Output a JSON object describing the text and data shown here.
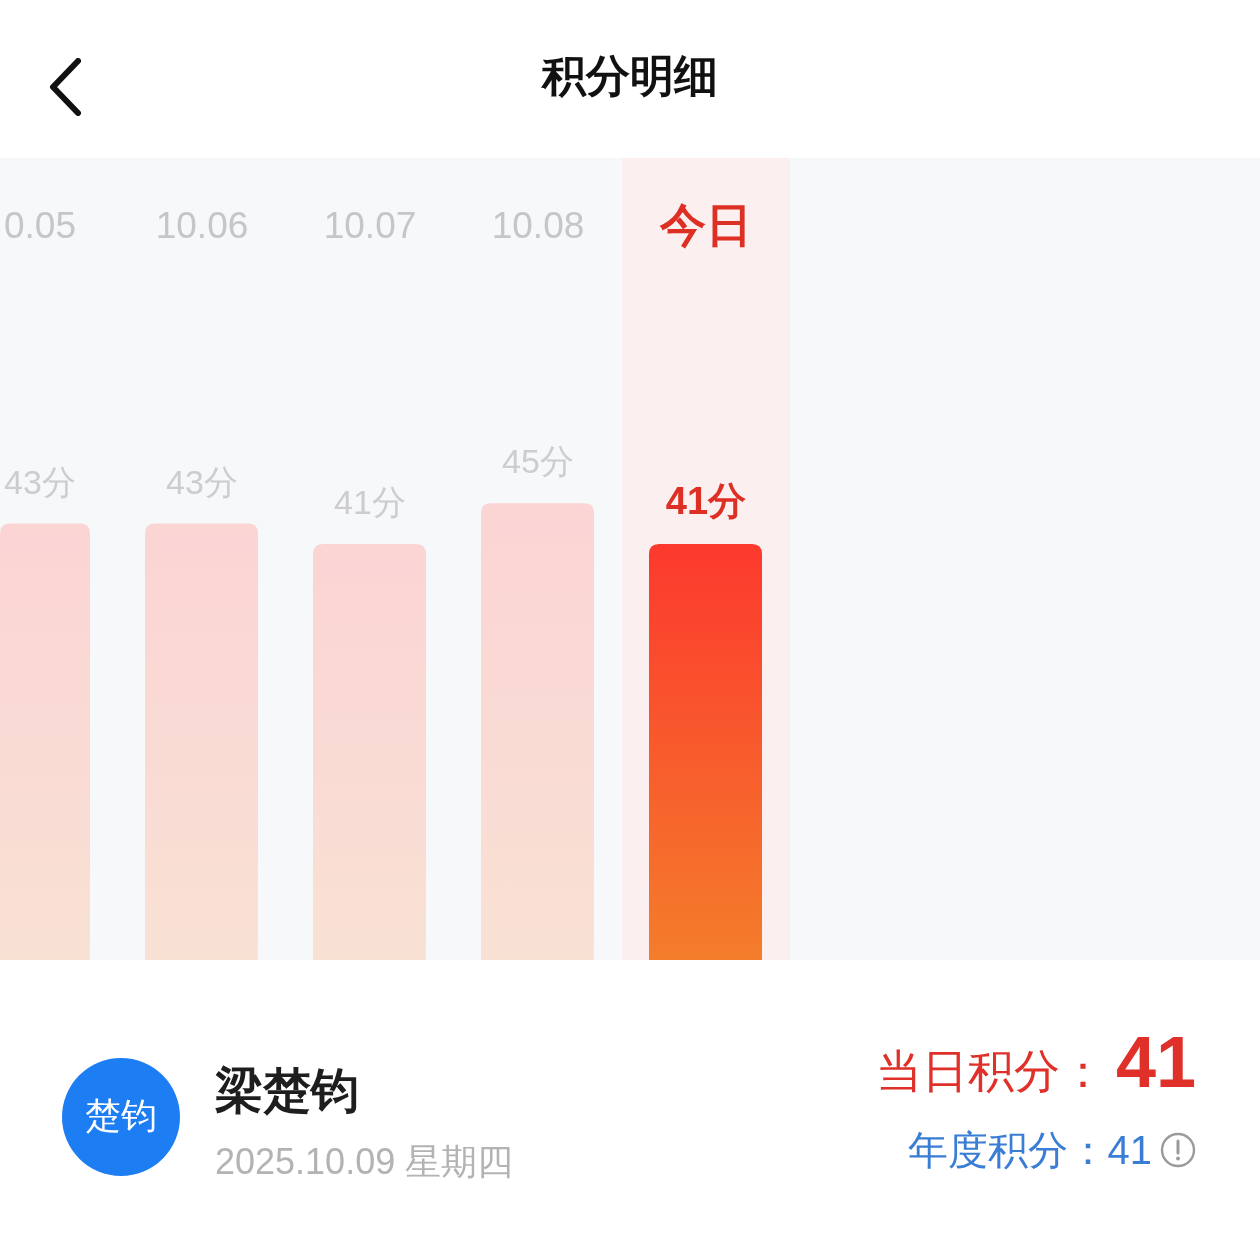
{
  "header": {
    "title": "积分明细"
  },
  "chart": {
    "chart_data": {
      "type": "bar",
      "categories": [
        "0.05",
        "10.06",
        "10.07",
        "10.08",
        "今日"
      ],
      "values": [
        43,
        43,
        41,
        45,
        41
      ],
      "value_labels": [
        "43分",
        "43分",
        "41分",
        "45分",
        "41分"
      ]
    },
    "columns": [
      {
        "selected": false
      },
      {
        "selected": false
      },
      {
        "selected": false
      },
      {
        "selected": false
      },
      {
        "selected": true
      }
    ]
  },
  "user": {
    "avatar_text": "楚钧",
    "name": "梁楚钧",
    "date": "2025.10.09 星期四"
  },
  "scores": {
    "daily_label": "当日积分：",
    "daily_value": "41",
    "annual_label": "年度积分：",
    "annual_value": "41"
  }
}
